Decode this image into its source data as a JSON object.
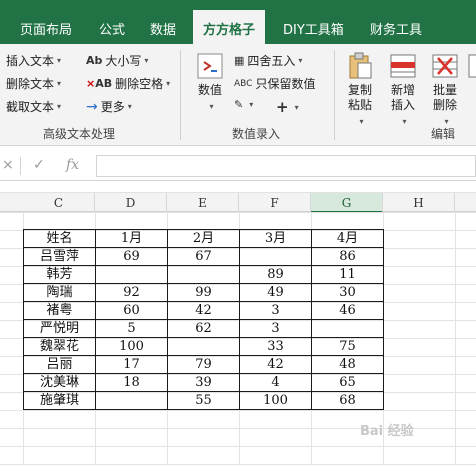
{
  "tabs": [
    "页面布局",
    "公式",
    "数据",
    "方方格子",
    "DIY工具箱",
    "财务工具"
  ],
  "ribbon": {
    "text_group": {
      "items": [
        "插入文本",
        "删除文本",
        "截取文本",
        "大小写",
        "删除空格",
        "更多"
      ],
      "label": "高级文本处理"
    },
    "number_group": {
      "number_btn": "数值",
      "round_btn": "四舍五入",
      "keep_numbers_btn": "只保留数值",
      "label": "数值录入"
    },
    "edit_group": {
      "copy_paste": "复制粘贴",
      "add_insert": "新增插入",
      "batch_delete": "批量删除",
      "label": "编辑"
    }
  },
  "formula_bar": {
    "cancel": "×",
    "confirm": "✓",
    "fx": "fx"
  },
  "columns": [
    "C",
    "D",
    "E",
    "F",
    "G",
    "H"
  ],
  "selected_column": "G",
  "table": {
    "header": [
      "姓名",
      "1月",
      "2月",
      "3月",
      "4月"
    ],
    "rows": [
      [
        "吕雪萍",
        "69",
        "67",
        "",
        "86"
      ],
      [
        "韩芳",
        "",
        "",
        "89",
        "11"
      ],
      [
        "陶瑞",
        "92",
        "99",
        "49",
        "30"
      ],
      [
        "褚粤",
        "60",
        "42",
        "3",
        "46"
      ],
      [
        "严悦明",
        "5",
        "62",
        "3",
        ""
      ],
      [
        "魏翠花",
        "100",
        "",
        "33",
        "75"
      ],
      [
        "吕丽",
        "17",
        "79",
        "42",
        "48"
      ],
      [
        "沈美琳",
        "18",
        "39",
        "4",
        "65"
      ],
      [
        "施肇琪",
        "",
        "55",
        "100",
        "68"
      ]
    ]
  },
  "watermark": "Bai 经验"
}
